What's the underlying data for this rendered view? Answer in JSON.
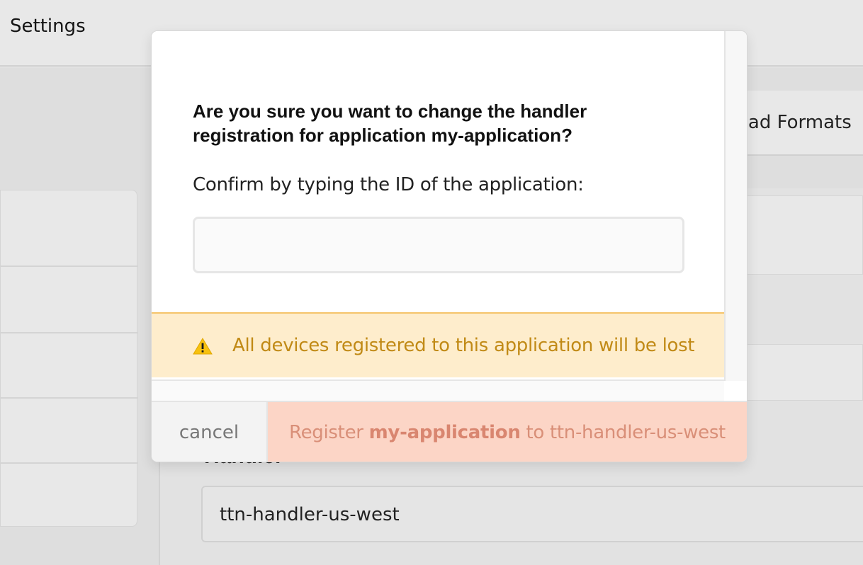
{
  "background": {
    "top_title": "Settings",
    "tab_label": "oad Formats",
    "handler_heading": "Handler",
    "handler_value": "ttn-handler-us-west"
  },
  "modal": {
    "question": "Are you sure you want to change the handler registration for application my-application?",
    "confirm_label": "Confirm by typing the ID of the application:",
    "confirm_input_value": "",
    "confirm_input_placeholder": "",
    "warning_icon": "warning-triangle-icon",
    "warning_text": "All devices registered to this application will be lost",
    "cancel_label": "cancel",
    "register_prefix": "Register ",
    "register_app": "my-application",
    "register_suffix": " to ttn-handler-us-west",
    "colors": {
      "warning_bg": "#feedcc",
      "warning_text": "#c18a16",
      "register_bg": "#fcd5c6",
      "register_text": "#d98f78"
    }
  }
}
